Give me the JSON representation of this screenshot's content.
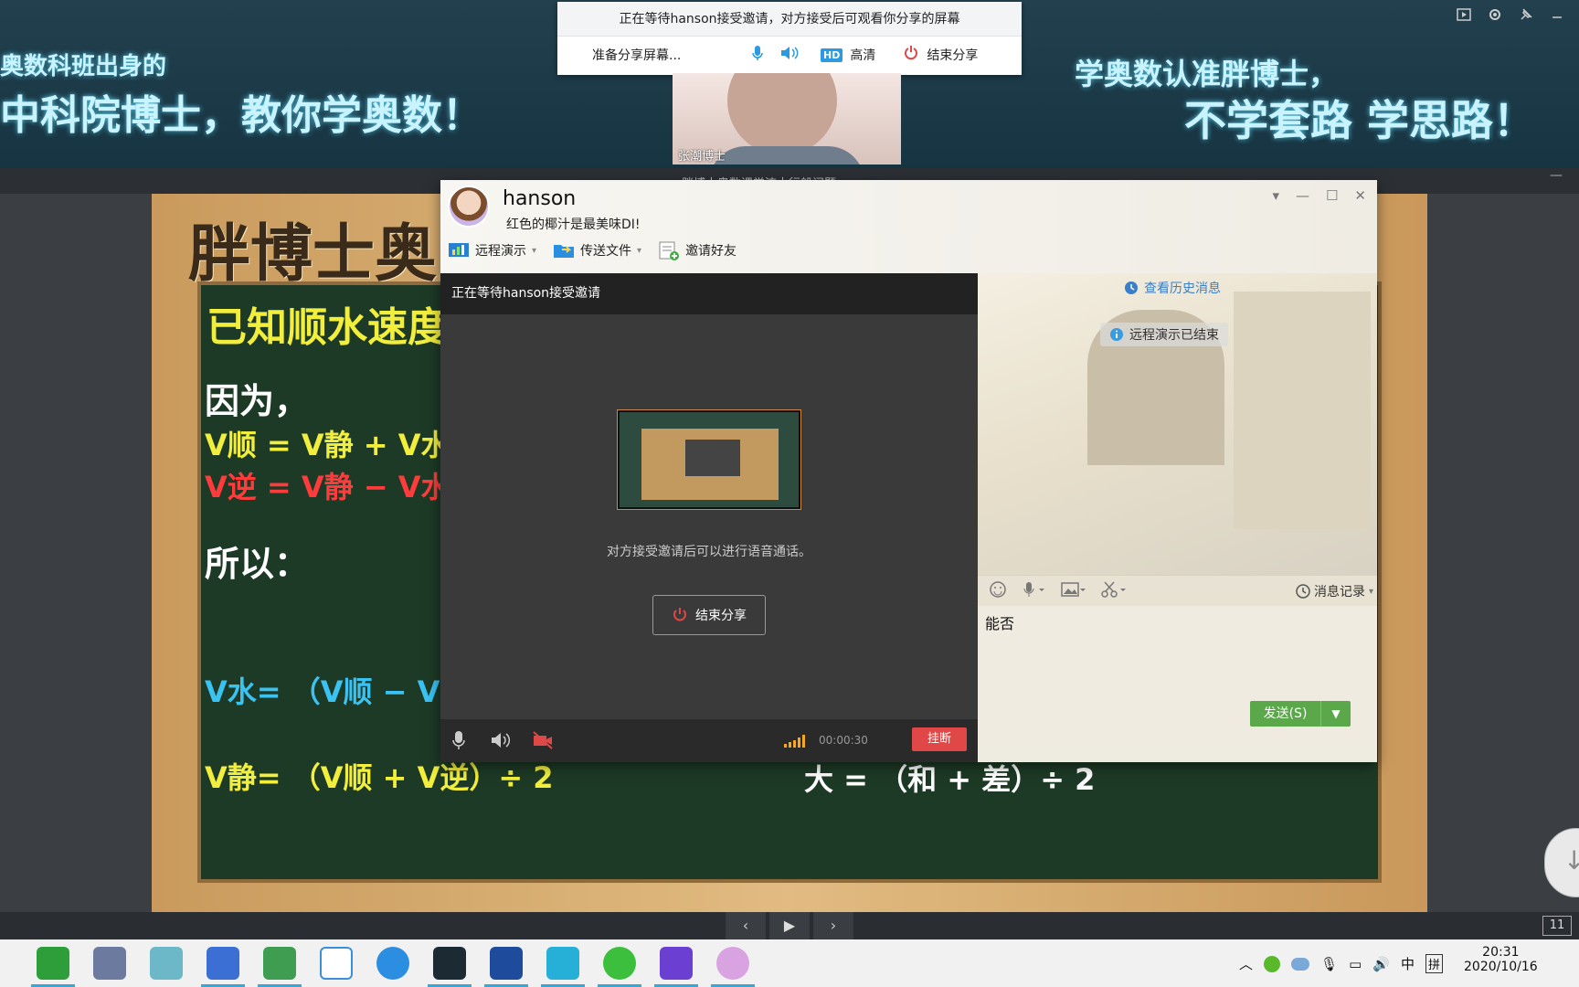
{
  "banner": {
    "left_line1": "奥数科班出身的",
    "left_line2": "中科院博士，教你学奥数！",
    "right_line1": "学奥数认准胖博士，",
    "right_line2": "不学套路 学思路！"
  },
  "sharebar": {
    "status": "正在等待hanson接受邀请，对方接受后可观看你分享的屏幕",
    "preparing": "准备分享屏幕...",
    "hd_badge": "HD",
    "hd_label": "高清",
    "end_share": "结束分享"
  },
  "cam": {
    "name": "张潮博士"
  },
  "strip": {
    "caption": "胖博士奥数课堂流水行船问题"
  },
  "board": {
    "title": "胖博士奥",
    "heading": "已知顺水速度",
    "because": "因为，",
    "so": "所以：",
    "eq1": "V顺 = V静 + V水",
    "eq2": "V逆 = V静 − V水",
    "eq3": "V水= （V顺 − V逆）",
    "eq4": "V静= （V顺 + V逆）÷ 2",
    "eq5": "大 = （和 + 差）÷ 2"
  },
  "chat": {
    "contact_name": "hanson",
    "signature": "红色的椰汁是最美味DI!",
    "toolbar": [
      "远程演示",
      "传送文件",
      "邀请好友"
    ],
    "video_status": "正在等待hanson接受邀请",
    "video_hint": "对方接受邀请后可以进行语音通话。",
    "end_share": "结束分享",
    "timer": "00:00:30",
    "hangup": "挂断",
    "history": "查看历史消息",
    "notice": "远程演示已结束",
    "msg_record": "消息记录",
    "input_text": "能否",
    "send": "发送(S)"
  },
  "nav": {
    "page": "11"
  },
  "taskbar": {
    "time": "20:31",
    "date": "2020/10/16",
    "ime1": "中",
    "ime2": "拼"
  },
  "colors": {
    "accent_green": "#5aa84a",
    "hangup_red": "#e04848",
    "board_green": "#1d3a26",
    "chalk_yellow": "#f2ee3c",
    "chalk_red": "#ff3b3b",
    "chalk_blue": "#39c2f2"
  }
}
